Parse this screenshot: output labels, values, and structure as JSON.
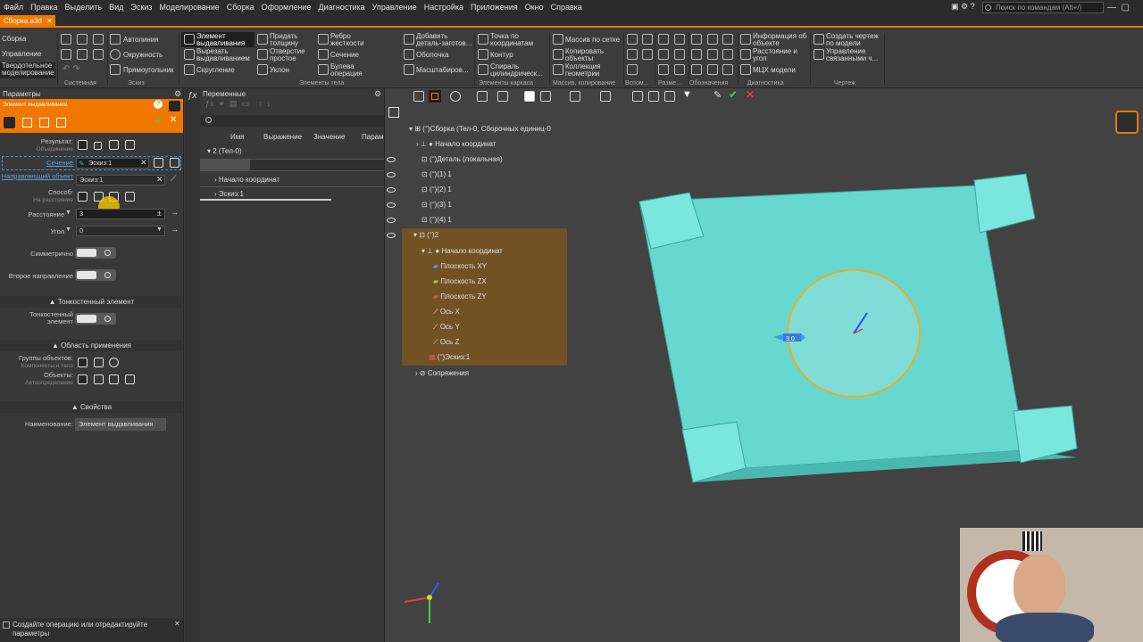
{
  "menu": [
    "Файл",
    "Правка",
    "Выделить",
    "Вид",
    "Эскиз",
    "Моделирование",
    "Сборка",
    "Оформление",
    "Диагностика",
    "Управление",
    "Настройка",
    "Приложения",
    "Окно",
    "Справка"
  ],
  "search": {
    "placeholder": "Поиск по командам (Alt+/)"
  },
  "doc_tab": "Сборка.a3d",
  "side_modes": [
    "Сборка",
    "Управление",
    "Твердотельное моделирование"
  ],
  "ribbon": {
    "col1": [
      "Автолиния",
      "Окружность",
      "Прямоугольник"
    ],
    "col2": [
      "Элемент выдавливания",
      "Вырезать выдавливанием",
      "Скругление"
    ],
    "col3": [
      "Придать толщину",
      "Отверстие простое",
      "Уклон"
    ],
    "col4": [
      "Ребро жесткости",
      "Сечение",
      "Булева операция"
    ],
    "col5": [
      "Добавить деталь-заготов...",
      "Оболочка",
      "Масштабиров..."
    ],
    "col6": [
      "Точка по координатам",
      "Контур",
      "Спираль цилиндрическ..."
    ],
    "col7": [
      "Массив по сетке",
      "Копировать объекты",
      "Коллекция геометрии"
    ],
    "col8": [
      "Информация об объекте",
      "Расстояние и угол",
      "МЦХ модели"
    ],
    "col9": [
      "Создать чертеж по модели",
      "Управление связанными ч..."
    ],
    "groups": [
      "Системная",
      "Эскиз",
      "Элементы тела",
      "Элементы каркаса",
      "Массив, копирование",
      "Вспом...",
      "Разме...",
      "Обозначения",
      "Диагностика",
      "Чертеж"
    ]
  },
  "params": {
    "panel_title": "Параметры",
    "op_title": "Элемент выдавливания",
    "result_label": "Результат:",
    "result_sub": "Объединение",
    "section_label": "Сечение",
    "section_value": "Эскиз:1",
    "direction_label": "Направляющий объект",
    "direction_value": "Эскиз:1",
    "method_label": "Способ:",
    "method_sub": "На расстояние",
    "distance_label": "Расстояние",
    "distance_value": "3",
    "angle_label": "Угол",
    "angle_value": "0",
    "symmetric_label": "Симметрично",
    "second_dir_label": "Второе направление",
    "thin_section": "Тонкостенный элемент",
    "thin_label": "Тонкостенный элемент",
    "scope_section": "Область применения",
    "groups_label": "Группы объектов:",
    "groups_sub": "Компоненты и тела",
    "objects_label": "Объекты:",
    "objects_sub": "Автоопределение",
    "props_section": "Свойства",
    "name_label": "Наименование:",
    "name_value": "Элемент выдавливания",
    "status": "Создайте операцию или отредактируйте параметры"
  },
  "vars": {
    "title": "Переменные",
    "columns": [
      "Имя",
      "Выражение",
      "Значение",
      "Парам"
    ],
    "root": "2 (Тел-0)",
    "items": [
      "Начало координат",
      "Эскиз:1"
    ]
  },
  "tree": {
    "root": "(־)Сборка (Тел-0, Сборочных единиц-0",
    "items": [
      "Начало координат",
      "(־)Деталь (локальная)",
      "(־)1 (1)",
      "(־)1 (2)",
      "(־)1 (3)",
      "(־)1 (4)",
      "(־)2",
      "Начало координат",
      "Плоскость XY",
      "Плоскость ZX",
      "Плоскость ZY",
      "Ось X",
      "Ось Y",
      "Ось Z",
      "(־)Эскиз:1",
      "Сопряжения"
    ]
  },
  "viewport": {
    "dimension_label": "3.0",
    "plate_color": "#67d8d0",
    "circle_color": "#e8b020"
  },
  "colors": {
    "accent": "#f07800",
    "highlight": "#7a5420"
  }
}
